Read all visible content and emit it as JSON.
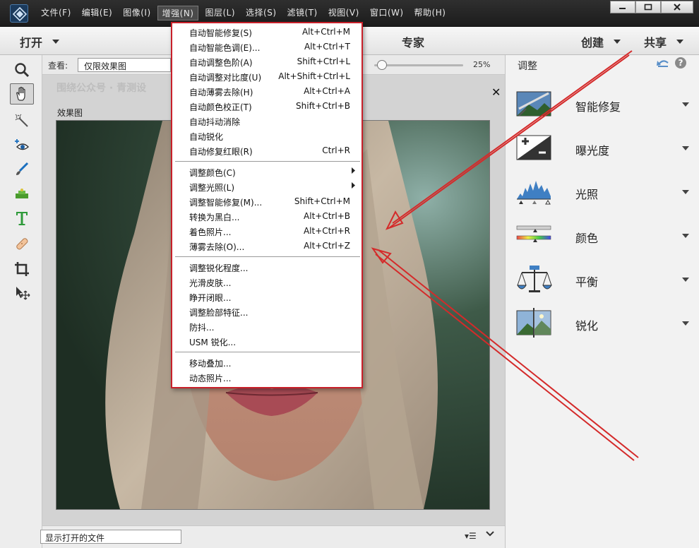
{
  "menubar": {
    "items": [
      "文件(F)",
      "编辑(E)",
      "图像(I)",
      "增强(N)",
      "图层(L)",
      "选择(S)",
      "滤镜(T)",
      "视图(V)",
      "窗口(W)",
      "帮助(H)"
    ],
    "active_index": 3
  },
  "window_controls": [
    "minimize-icon",
    "maximize-icon",
    "close-icon"
  ],
  "modebar": {
    "open_label": "打开",
    "mode_label": "专家",
    "create_label": "创建",
    "share_label": "共享"
  },
  "tools": [
    "zoom-icon",
    "hand-icon",
    "quick-selection-icon",
    "eye-icon",
    "brush-icon",
    "paint-bucket-icon",
    "text-icon",
    "healing-bandage-icon",
    "crop-icon",
    "move-icon"
  ],
  "options": {
    "view_label": "查看:",
    "view_value": "仅限效果图",
    "zoom_value": "25%"
  },
  "canvas": {
    "doc_label": "效果图",
    "watermark": "围绕公众号 · 青测设"
  },
  "bottombar": {
    "files_select": "显示打开的文件",
    "list_options": "▾☰"
  },
  "adjust_panel": {
    "title": "调整",
    "items": [
      {
        "label": "智能修复",
        "icon": "smart-fix-icon"
      },
      {
        "label": "曝光度",
        "icon": "exposure-icon"
      },
      {
        "label": "光照",
        "icon": "lighting-histogram-icon"
      },
      {
        "label": "颜色",
        "icon": "color-slider-icon"
      },
      {
        "label": "平衡",
        "icon": "balance-scale-icon"
      },
      {
        "label": "锐化",
        "icon": "sharpen-icon"
      }
    ]
  },
  "enhance_menu": {
    "groups": [
      [
        {
          "label": "自动智能修复(S)",
          "shortcut": "Alt+Ctrl+M"
        },
        {
          "label": "自动智能色调(E)...",
          "shortcut": "Alt+Ctrl+T"
        },
        {
          "label": "自动调整色阶(A)",
          "shortcut": "Shift+Ctrl+L"
        },
        {
          "label": "自动调整对比度(U)",
          "shortcut": "Alt+Shift+Ctrl+L"
        },
        {
          "label": "自动薄雾去除(H)",
          "shortcut": "Alt+Ctrl+A"
        },
        {
          "label": "自动颜色校正(T)",
          "shortcut": "Shift+Ctrl+B"
        },
        {
          "label": "自动抖动消除",
          "shortcut": ""
        },
        {
          "label": "自动锐化",
          "shortcut": ""
        },
        {
          "label": "自动修复红眼(R)",
          "shortcut": "Ctrl+R"
        }
      ],
      [
        {
          "label": "调整颜色(C)",
          "shortcut": "",
          "submenu": true
        },
        {
          "label": "调整光照(L)",
          "shortcut": "",
          "submenu": true
        },
        {
          "label": "调整智能修复(M)...",
          "shortcut": "Shift+Ctrl+M"
        },
        {
          "label": "转换为黑白...",
          "shortcut": "Alt+Ctrl+B"
        },
        {
          "label": "着色照片...",
          "shortcut": "Alt+Ctrl+R"
        },
        {
          "label": "薄雾去除(O)...",
          "shortcut": "Alt+Ctrl+Z"
        }
      ],
      [
        {
          "label": "调整锐化程度...",
          "shortcut": ""
        },
        {
          "label": "光滑皮肤...",
          "shortcut": ""
        },
        {
          "label": "睁开闭眼...",
          "shortcut": ""
        },
        {
          "label": "调整脸部特征...",
          "shortcut": ""
        },
        {
          "label": "防抖...",
          "shortcut": ""
        },
        {
          "label": "USM 锐化...",
          "shortcut": ""
        }
      ],
      [
        {
          "label": "移动叠加...",
          "shortcut": ""
        },
        {
          "label": "动态照片...",
          "shortcut": ""
        }
      ]
    ]
  },
  "colors": {
    "menu_border": "#c8202a",
    "annotation_arrow": "#d42a2a",
    "titlebar_bg": "#262626"
  }
}
